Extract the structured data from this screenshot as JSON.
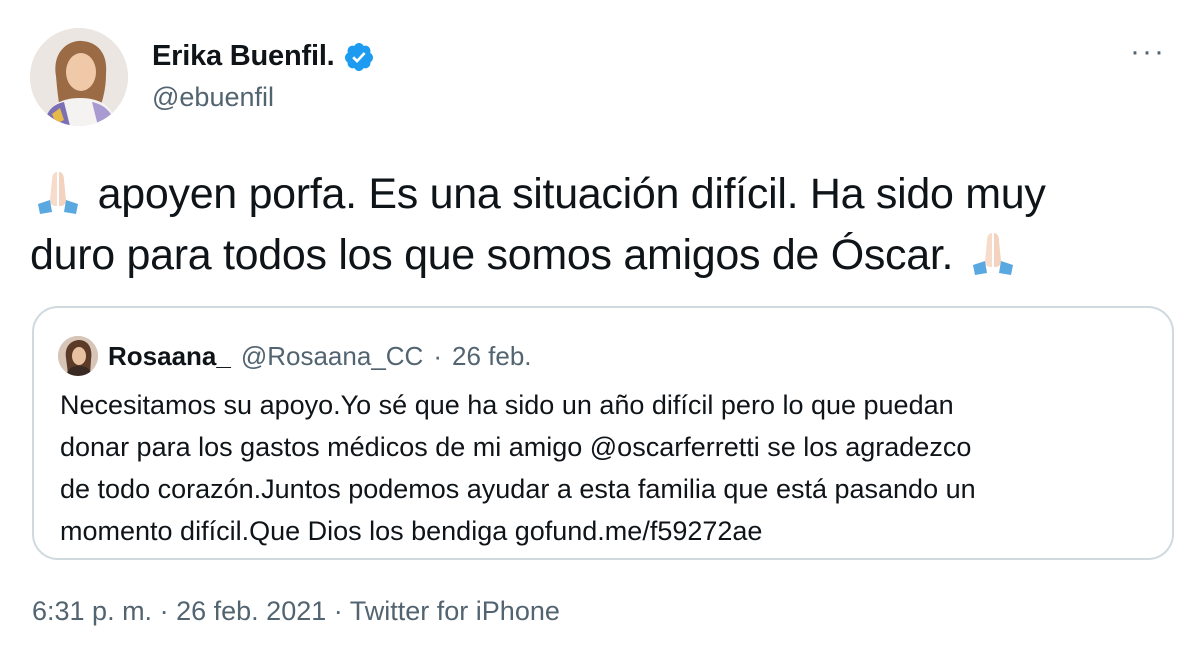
{
  "author": {
    "display_name": "Erika Buenfil.",
    "handle": "@ebuenfil",
    "verified": true
  },
  "more_menu": "···",
  "tweet": {
    "line1_text": " apoyen porfa.  Es una situación difícil. Ha sido muy",
    "line2_text": "duro para todos los que somos amigos de Óscar. ",
    "emoji": "folded-hands-icon"
  },
  "quoted_tweet": {
    "display_name": "Rosaana_",
    "handle": "@Rosaana_CC",
    "date": "26 feb.",
    "separator": "·",
    "lines": [
      "Necesitamos su apoyo.Yo sé que ha sido un año difícil pero lo que puedan",
      "donar para los gastos médicos de mi amigo @oscarferretti se los agradezco",
      "de todo corazón.Juntos podemos ayudar a esta familia que está pasando un",
      "momento difícil.Que Dios los bendiga gofund.me/f59272ae"
    ]
  },
  "footer": {
    "time": "6:31 p. m.",
    "date": "26 feb. 2021",
    "source": "Twitter for iPhone",
    "separator": "·"
  },
  "colors": {
    "text": "#0f1419",
    "secondary": "#536471",
    "verified_blue": "#1d9bf0",
    "border": "#cfd9de"
  }
}
